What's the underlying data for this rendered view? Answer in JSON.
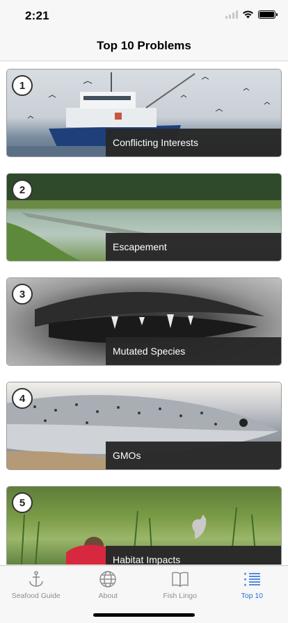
{
  "status_bar": {
    "time": "2:21",
    "icons": [
      "signal-icon",
      "wifi-icon",
      "battery-icon"
    ]
  },
  "header": {
    "title": "Top 10 Problems"
  },
  "items": [
    {
      "rank": "1",
      "title": "Conflicting Interests"
    },
    {
      "rank": "2",
      "title": "Escapement"
    },
    {
      "rank": "3",
      "title": "Mutated Species"
    },
    {
      "rank": "4",
      "title": "GMOs"
    },
    {
      "rank": "5",
      "title": "Habitat Impacts"
    }
  ],
  "tab_bar": {
    "tabs": [
      {
        "label": "Seafood Guide",
        "icon": "anchor-icon"
      },
      {
        "label": "About",
        "icon": "globe-icon"
      },
      {
        "label": "Fish Lingo",
        "icon": "book-icon"
      },
      {
        "label": "Top 10",
        "icon": "list-icon"
      }
    ],
    "active": "Top 10"
  },
  "colors": {
    "accent": "#2d6fd6",
    "caption_bg": "#282828",
    "inactive_tab": "#8e8e93"
  }
}
